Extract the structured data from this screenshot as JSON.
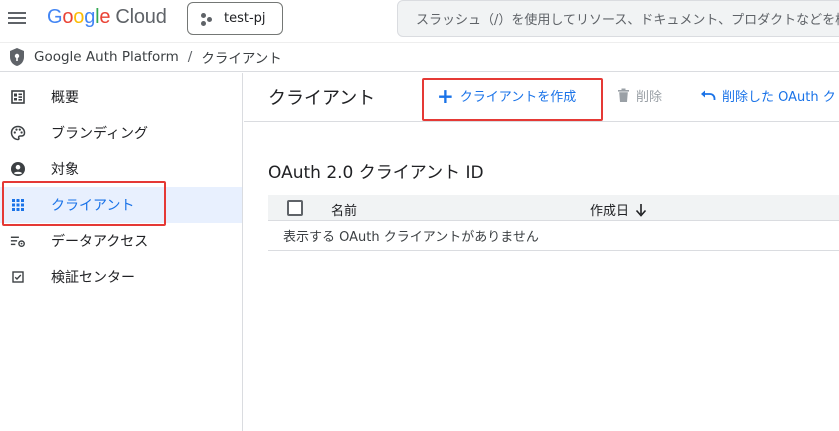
{
  "header": {
    "logo_google": "Google",
    "logo_cloud": "Cloud",
    "project": "test-pj",
    "search_placeholder": "スラッシュ（/）を使用してリソース、ドキュメント、プロダクトなどを検索"
  },
  "breadcrumb": {
    "product": "Google Auth Platform",
    "separator": "/",
    "current": "クライアント"
  },
  "sidebar": {
    "items": [
      {
        "label": "概要",
        "icon": "dashboard-icon"
      },
      {
        "label": "ブランディング",
        "icon": "palette-icon"
      },
      {
        "label": "対象",
        "icon": "account-circle-icon"
      },
      {
        "label": "クライアント",
        "icon": "apps-grid-icon",
        "active": true
      },
      {
        "label": "データアクセス",
        "icon": "list-settings-icon"
      },
      {
        "label": "検証センター",
        "icon": "checkbox-icon"
      }
    ]
  },
  "main": {
    "title": "クライアント",
    "actions": {
      "create": "クライアントを作成",
      "delete": "削除",
      "restore": "削除した OAuth ク"
    },
    "section_title": "OAuth 2.0 クライアント ID",
    "table": {
      "columns": [
        "名前",
        "作成日"
      ],
      "empty_message": "表示する OAuth クライアントがありません"
    }
  },
  "colors": {
    "accent": "#1a73e8",
    "highlight_box": "#e53935",
    "active_bg": "#e8f0fe"
  }
}
